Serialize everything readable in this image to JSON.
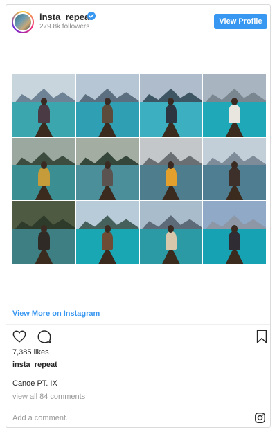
{
  "header": {
    "username": "insta_repeat",
    "followers": "279.8k followers",
    "view_profile_label": "View Profile"
  },
  "grid": {
    "tiles": [
      {
        "sky": "#c9d5dd",
        "mtn": "#6f8396",
        "water": "#3ba6ad",
        "person": "#4a3a44",
        "icon": "canoe-photo"
      },
      {
        "sky": "#b7c6d4",
        "mtn": "#5b6f80",
        "water": "#2f9fb3",
        "person": "#5c4a3a",
        "icon": "canoe-photo"
      },
      {
        "sky": "#aebccb",
        "mtn": "#3e5564",
        "water": "#3cb0c0",
        "person": "#2d3540",
        "icon": "canoe-photo"
      },
      {
        "sky": "#a8b4bf",
        "mtn": "#7a8791",
        "water": "#1fa9b8",
        "person": "#e9e6df",
        "icon": "canoe-photo"
      },
      {
        "sky": "#9aa89f",
        "mtn": "#3c4c3f",
        "water": "#3b8e91",
        "person": "#c69b3a",
        "icon": "canoe-photo"
      },
      {
        "sky": "#a3ada1",
        "mtn": "#35463a",
        "water": "#4b8f9a",
        "person": "#5a5350",
        "icon": "canoe-photo"
      },
      {
        "sky": "#c3c7c9",
        "mtn": "#6a6f74",
        "water": "#4e7d8e",
        "person": "#e3a02c",
        "icon": "canoe-photo"
      },
      {
        "sky": "#c3cfd8",
        "mtn": "#7d8c98",
        "water": "#4f7e93",
        "person": "#3d2f2a",
        "icon": "canoe-photo"
      },
      {
        "sky": "#4e5a41",
        "mtn": "#2f3b2a",
        "water": "#3e7f83",
        "person": "#2f2a26",
        "icon": "canoe-photo"
      },
      {
        "sky": "#b7cbd8",
        "mtn": "#46605c",
        "water": "#1aa7b4",
        "person": "#6d4b35",
        "icon": "canoe-photo"
      },
      {
        "sky": "#a9bccb",
        "mtn": "#5d6a78",
        "water": "#2c9aa4",
        "person": "#d8c7aa",
        "icon": "canoe-photo"
      },
      {
        "sky": "#8fa9c7",
        "mtn": "#8d97a6",
        "water": "#17a2b3",
        "person": "#2f2d33",
        "icon": "canoe-photo"
      }
    ]
  },
  "links": {
    "view_more": "View More on Instagram"
  },
  "actions": {
    "like_icon": "heart-icon",
    "comment_icon": "comment-icon",
    "save_icon": "bookmark-icon"
  },
  "post": {
    "likes": "7,385 likes",
    "owner": "insta_repeat",
    "caption": "Canoe PT. IX",
    "view_comments": "view all 84 comments"
  },
  "comment": {
    "placeholder": "Add a comment..."
  },
  "colors": {
    "accent": "#3897f0",
    "verified": "#3897f0",
    "muted": "#8e8e8e"
  }
}
